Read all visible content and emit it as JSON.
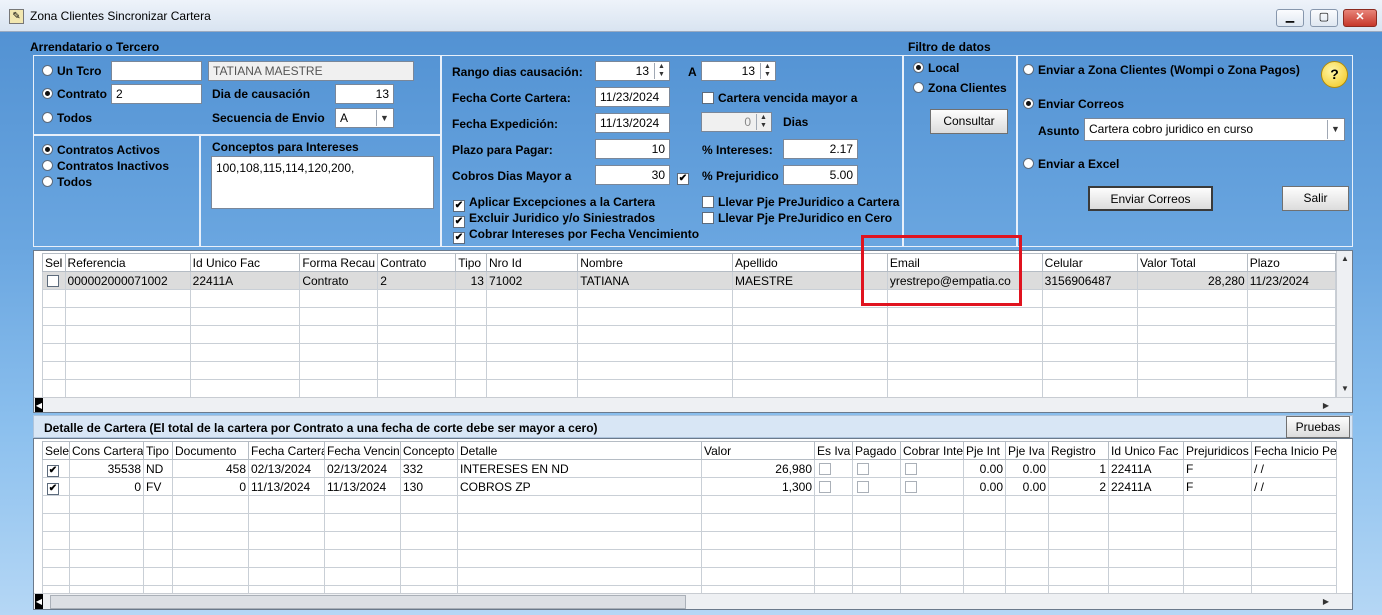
{
  "window": {
    "title": "Zona Clientes Sincronizar Cartera",
    "min": "▁",
    "max": "▢",
    "close": "✕"
  },
  "arrendatario": {
    "title": "Arrendatario o Tercero",
    "un_tcro": "Un Tcro",
    "un_tcro_value": "",
    "name_value": "TATIANA MAESTRE",
    "contrato": "Contrato",
    "contrato_value": "2",
    "todos": "Todos",
    "dia_causacion_label": "Dia de causación",
    "dia_causacion_value": "13",
    "secuencia_label": "Secuencia de Envio",
    "secuencia_value": "A"
  },
  "contratos": {
    "activos": "Contratos Activos",
    "inactivos": "Contratos Inactivos",
    "todos": "Todos"
  },
  "conceptos": {
    "title": "Conceptos para Intereses",
    "value": "100,108,115,114,120,200,"
  },
  "params": {
    "rango_label": "Rango dias causación:",
    "rango_from": "13",
    "rango_a": "A",
    "rango_to": "13",
    "fecha_corte_label": "Fecha Corte Cartera:",
    "fecha_corte": "11/23/2024",
    "cartera_vencida": "Cartera vencida mayor a",
    "fecha_exp_label": "Fecha Expedición:",
    "fecha_exp": "11/13/2024",
    "dias_value": "0",
    "dias_label": "Dias",
    "plazo_label": "Plazo para Pagar:",
    "plazo_value": "10",
    "intereses_label": "% Intereses:",
    "intereses_value": "2.17",
    "cobros_label": "Cobros Dias Mayor a",
    "cobros_value": "30",
    "prejuridico_label": "% Prejuridico",
    "prejuridico_value": "5.00",
    "chk_excepciones": "Aplicar Excepciones a la Cartera",
    "chk_excluir": "Excluir Juridico y/o Siniestrados",
    "chk_cobrar": "Cobrar Intereses por Fecha Vencimiento",
    "chk_llevar_pje": "Llevar Pje PreJuridico a Cartera",
    "chk_llevar_cero": "Llevar Pje PreJuridico en Cero"
  },
  "filtro": {
    "title": "Filtro de datos",
    "local": "Local",
    "zona": "Zona Clientes",
    "consultar": "Consultar"
  },
  "envio": {
    "zona": "Enviar a Zona Clientes (Wompi o Zona Pagos)",
    "correos": "Enviar Correos",
    "asunto_label": "Asunto",
    "asunto_value": "Cartera cobro juridico en curso",
    "excel": "Enviar a Excel",
    "enviar_btn": "Enviar Correos",
    "salir_btn": "Salir",
    "help": "?"
  },
  "top_table": {
    "headers": [
      "Sel",
      "Referencia",
      "Id Unico Fac",
      "Forma Recau",
      "Contrato",
      "Tipo",
      "Nro Id",
      "Nombre",
      "Apellido",
      "Email",
      "Celular",
      "Valor Total",
      "Plazo"
    ],
    "row": [
      "",
      "000002000071002",
      "22411A",
      "Contrato",
      "2",
      "13",
      "71002",
      "TATIANA",
      "MAESTRE",
      "yrestrepo@empatia.co",
      "3156906487",
      "28,280",
      "11/23/2024"
    ]
  },
  "detalle": {
    "title": "Detalle de Cartera (El total de la cartera por Contrato a una fecha de corte debe ser mayor a cero)",
    "pruebas": "Pruebas",
    "headers": [
      "Sele",
      "Cons Cartera",
      "Tipo",
      "Documento",
      "Fecha Cartera",
      "Fecha Vencin",
      "Concepto",
      "Detalle",
      "Valor",
      "Es Iva",
      "Pagado",
      "Cobrar Inte",
      "Pje Int",
      "Pje Iva",
      "Registro",
      "Id Unico Fac",
      "Prejuridicos",
      "Fecha Inicio Pe"
    ],
    "rows": [
      [
        "✔",
        "35538",
        "ND",
        "458",
        "02/13/2024",
        "02/13/2024",
        "332",
        "INTERESES EN ND",
        "26,980",
        "",
        "",
        "",
        "0.00",
        "0.00",
        "1",
        "22411A",
        "F",
        "/  /"
      ],
      [
        "✔",
        "0",
        "FV",
        "0",
        "11/13/2024",
        "11/13/2024",
        "130",
        "COBROS ZP",
        "1,300",
        "",
        "",
        "",
        "0.00",
        "0.00",
        "2",
        "22411A",
        "F",
        "/  /"
      ]
    ]
  }
}
